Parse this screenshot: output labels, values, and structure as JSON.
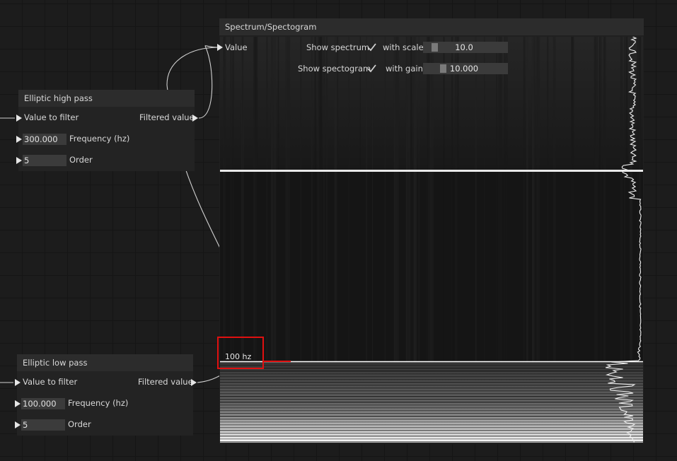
{
  "spectrum_node": {
    "title": "Spectrum/Spectogram",
    "value_label": "Value",
    "show_spectrum_label": "Show spectrum",
    "with_scale_label": "with scale",
    "scale_value": "10.0",
    "show_spectogram_label": "Show spectogram",
    "with_gain_label": "with gain",
    "gain_value": "10.000",
    "show_spectrum_checked": true,
    "show_spectogram_checked": true,
    "marker_label": "100 hz",
    "marker_color": "#e01010"
  },
  "high_pass_node": {
    "title": "Elliptic high pass",
    "input_label": "Value to filter",
    "output_label": "Filtered value",
    "frequency_value": "300.000",
    "frequency_label": "Frequency (hz)",
    "order_value": "5",
    "order_label": "Order"
  },
  "low_pass_node": {
    "title": "Elliptic low pass",
    "input_label": "Value to filter",
    "output_label": "Filtered value",
    "frequency_value": "100.000",
    "frequency_label": "Frequency (hz)",
    "order_value": "5",
    "order_label": "Order"
  }
}
